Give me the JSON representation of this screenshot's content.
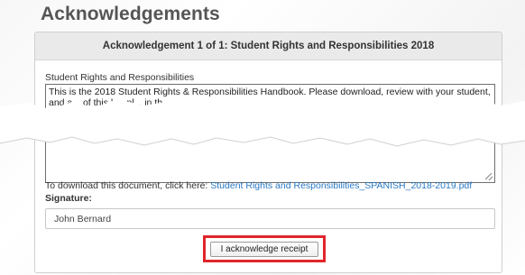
{
  "page": {
    "title": "Acknowledgements"
  },
  "acknowledgement": {
    "header": "Acknowledgement 1 of 1: Student Rights and Responsibilities 2018",
    "document_label": "Student Rights and Responsibilities",
    "document_text_line1": "This is the 2018 Student Rights & Responsibilities Handbook.  Please download, review with your student,",
    "document_text_line2": "and a... of this h... pl... in th...",
    "download_prefix": "To download this document, click here: ",
    "download_link": "Student Rights and Responsibilities_SPANISH_2018-2019.pdf",
    "signature_label": "Signature:",
    "signature_value": "John Bernard",
    "acknowledge_button": "I acknowledge receipt"
  },
  "colors": {
    "highlight": "#e0262c",
    "link": "#2a78c2"
  }
}
